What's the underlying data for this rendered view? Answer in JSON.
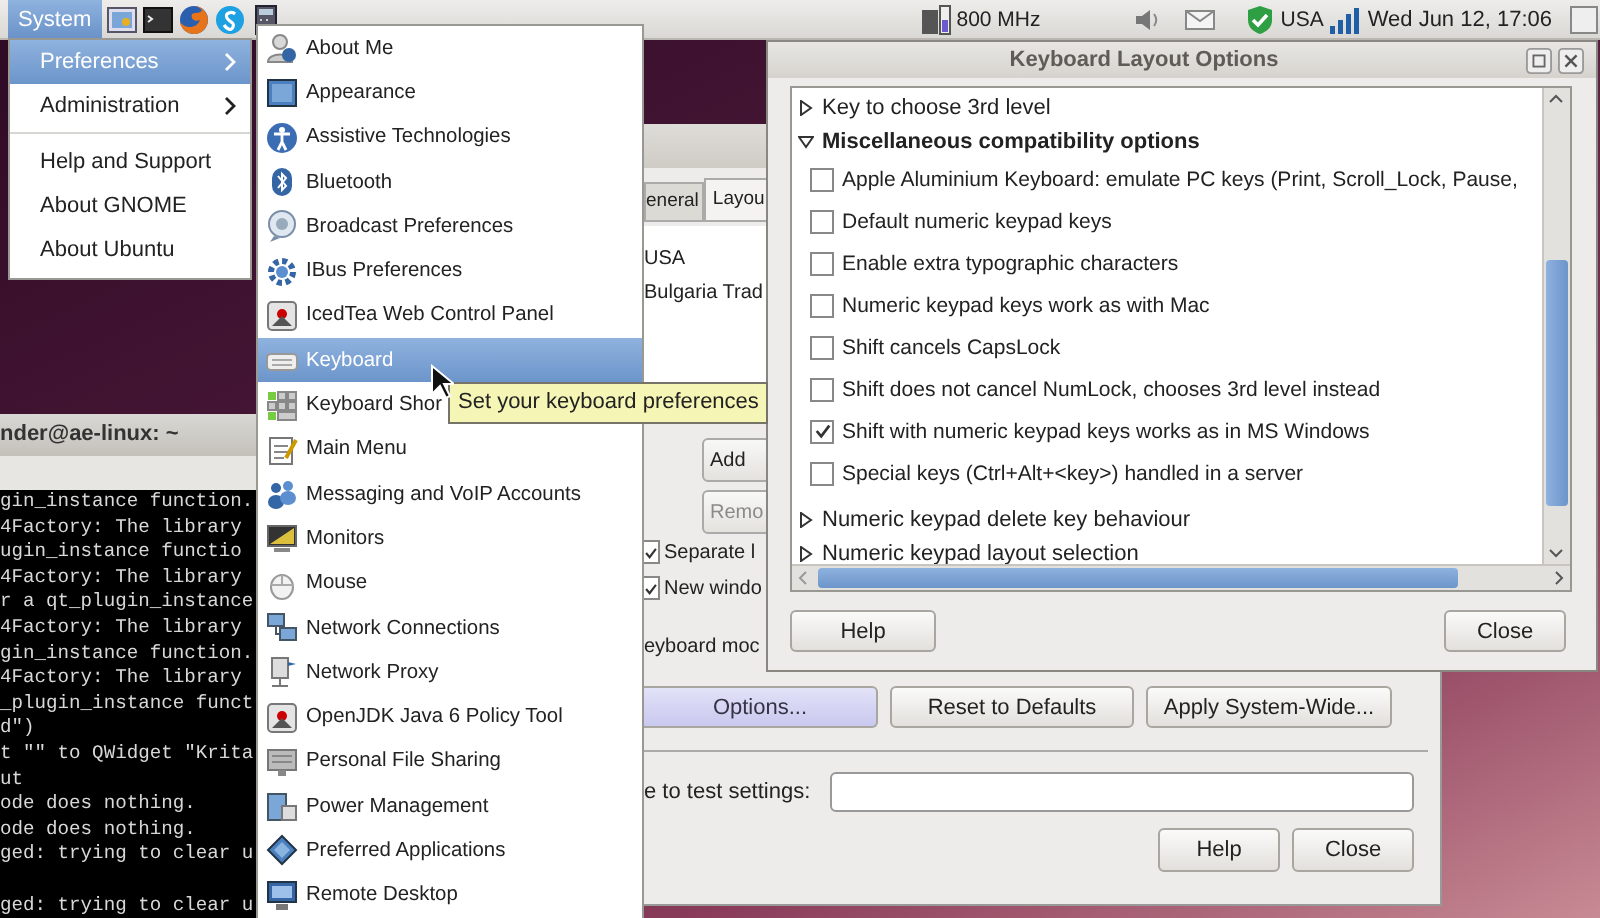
{
  "top_panel": {
    "menu_button": {
      "label": "System",
      "selected": true
    },
    "cpu_frequency": "800 MHz",
    "keyboard_layout": "USA",
    "clock": "Wed Jun 12, 17:06"
  },
  "terminal": {
    "title": "nder@ae-linux: ~",
    "blocks": [
      [
        "gin_instance function.",
        "4Factory: The library",
        "ugin_instance functio",
        "4Factory: The library",
        "r a qt_plugin_instance",
        "4Factory: The library",
        "gin_instance function.",
        "4Factory: The library",
        "_plugin_instance funct",
        "d\")",
        "t \"\" to QWidget \"Krita",
        "ut",
        "ode does nothing.",
        "ode does nothing.",
        "ged: trying to clear u"
      ],
      [
        "ged: trying to clear u"
      ]
    ]
  },
  "keyboard_preferences": {
    "tabs": [
      {
        "label": "eneral",
        "selected": false
      },
      {
        "label": "Layou",
        "selected": true
      }
    ],
    "layouts": [
      "USA",
      "Bulgaria Trad"
    ],
    "list_buttons": [
      {
        "label": "Add",
        "disabled": false
      },
      {
        "label": "Remo",
        "disabled": true
      }
    ],
    "options": [
      {
        "label": "Separate l",
        "checked": true
      },
      {
        "label": "New windo",
        "checked": true
      }
    ],
    "model_label": "eyboard moc",
    "action_buttons": [
      {
        "label": "Options...",
        "selected": true
      },
      {
        "label": "Reset to Defaults",
        "selected": false
      },
      {
        "label": "Apply System-Wide...",
        "selected": false
      }
    ],
    "test_label": "e to test settings:",
    "footer_buttons": [
      "Help",
      "Close"
    ]
  },
  "layout_options_dialog": {
    "title": "Keyboard Layout Options",
    "tree": [
      {
        "label": "Key to choose 3rd level",
        "expanded": false
      },
      {
        "label": "Miscellaneous compatibility options",
        "expanded": true,
        "children": [
          {
            "label": "Apple Aluminium Keyboard: emulate PC keys (Print, Scroll_Lock, Pause,",
            "checked": false
          },
          {
            "label": "Default numeric keypad keys",
            "checked": false
          },
          {
            "label": "Enable extra typographic characters",
            "checked": false
          },
          {
            "label": "Numeric keypad keys work as with Mac",
            "checked": false
          },
          {
            "label": "Shift cancels CapsLock",
            "checked": false
          },
          {
            "label": "Shift does not cancel NumLock, chooses 3rd level instead",
            "checked": false
          },
          {
            "label": "Shift with numeric keypad keys works as in MS Windows",
            "checked": true
          },
          {
            "label": "Special keys (Ctrl+Alt+<key>) handled in a server",
            "checked": false
          }
        ]
      },
      {
        "label": "Numeric keypad delete key behaviour",
        "expanded": false
      },
      {
        "label": "Numeric keypad layout selection",
        "expanded": false
      }
    ],
    "buttons": [
      "Help",
      "Close"
    ]
  },
  "system_menu": {
    "groups": [
      [
        {
          "label": "Preferences",
          "selected": true,
          "submenu": true
        },
        {
          "label": "Administration",
          "selected": false,
          "submenu": true
        }
      ],
      [
        {
          "label": "Help and Support",
          "selected": false,
          "submenu": false
        },
        {
          "label": "About GNOME",
          "selected": false,
          "submenu": false
        },
        {
          "label": "About Ubuntu",
          "selected": false,
          "submenu": false
        }
      ]
    ]
  },
  "preferences_menu": {
    "items": [
      {
        "label": "About Me",
        "selected": false
      },
      {
        "label": "Appearance",
        "selected": false
      },
      {
        "label": "Assistive Technologies",
        "selected": false
      },
      {
        "label": "Bluetooth",
        "selected": false
      },
      {
        "label": "Broadcast Preferences",
        "selected": false
      },
      {
        "label": "IBus Preferences",
        "selected": false
      },
      {
        "label": "IcedTea Web Control Panel",
        "selected": false
      },
      {
        "label": "Keyboard",
        "selected": true
      },
      {
        "label": "Keyboard Shor",
        "selected": false
      },
      {
        "label": "Main Menu",
        "selected": false
      },
      {
        "label": "Messaging and VoIP Accounts",
        "selected": false
      },
      {
        "label": "Monitors",
        "selected": false
      },
      {
        "label": "Mouse",
        "selected": false
      },
      {
        "label": "Network Connections",
        "selected": false
      },
      {
        "label": "Network Proxy",
        "selected": false
      },
      {
        "label": "OpenJDK Java 6 Policy Tool",
        "selected": false
      },
      {
        "label": "Personal File Sharing",
        "selected": false
      },
      {
        "label": "Power Management",
        "selected": false
      },
      {
        "label": "Preferred Applications",
        "selected": false
      },
      {
        "label": "Remote Desktop",
        "selected": false
      }
    ]
  },
  "tooltip": "Set your keyboard preferences"
}
